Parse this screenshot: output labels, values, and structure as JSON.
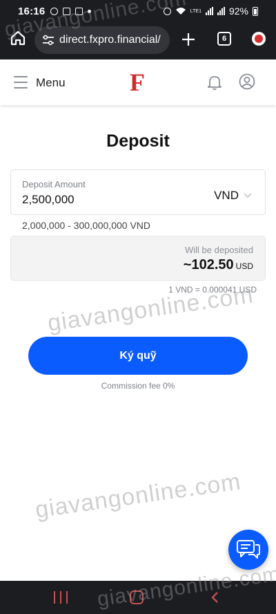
{
  "status_bar": {
    "time": "16:16",
    "battery": "92%",
    "network": "LTE1"
  },
  "browser": {
    "url": "direct.fxpro.financial/",
    "tab_count": "6"
  },
  "header": {
    "menu_label": "Menu",
    "logo_letter": "F"
  },
  "page": {
    "title": "Deposit"
  },
  "deposit": {
    "amount_label": "Deposit Amount",
    "amount_value": "2,500,000",
    "currency": "VND",
    "range": "2,000,000 - 300,000,000 VND",
    "will_be_deposited_label": "Will be deposited",
    "will_be_deposited_value": "~102.50",
    "will_be_deposited_currency": "USD",
    "rate": "1 VND = 0.000041 USD",
    "submit_label": "Ký quỹ",
    "commission": "Commission fee 0%"
  },
  "watermarks": [
    "giavangonline.com",
    "giavangonline.com",
    "giavangonline.com",
    "giavangonline.com"
  ],
  "colors": {
    "accent": "#0b5cff",
    "brand_red": "#d42a2a",
    "chrome": "#1c1d21"
  },
  "icons": [
    "home-icon",
    "tune-icon",
    "plus-icon",
    "tabs-icon",
    "extension-icon",
    "hamburger-icon",
    "bell-icon",
    "user-icon",
    "chevron-down-icon",
    "chat-icon",
    "recent-apps-icon",
    "home-nav-icon",
    "back-icon"
  ]
}
